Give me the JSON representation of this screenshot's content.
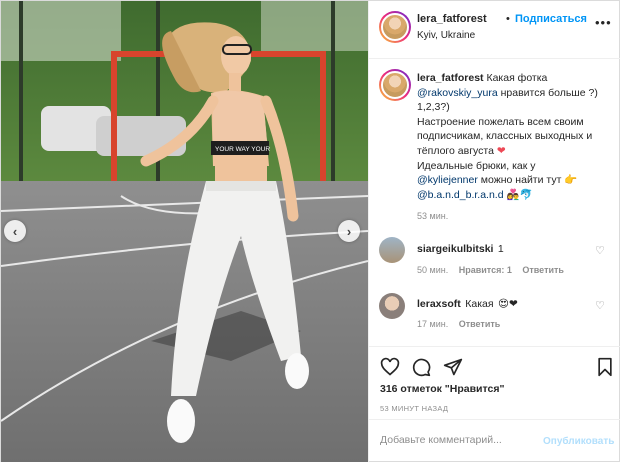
{
  "header": {
    "username": "lera_fatforest",
    "dot": "•",
    "follow_label": "Подписаться",
    "location": "Kyiv, Ukraine",
    "more": "•••",
    "more_icon": "more-horizontal-icon"
  },
  "caption": {
    "username": "lera_fatforest",
    "part1": "Какая фотка",
    "mention1": "@rakovskiy_yura",
    "part2": "нравится больше ?) 1,2,3?)",
    "part3": "Настроение пожелать всем своим подписчикам, классных выходных и тёплого августа",
    "heart": "❤",
    "part4": "Идеальные брюки, как у",
    "mention2": "@kyliejenner",
    "part5": "можно найти тут",
    "emoji_point": "👉",
    "mention3": "@b.a.n.d_b.r.a.n.d",
    "emoji_end": "👩‍❤️‍👨🐬",
    "time": "53 мин."
  },
  "comments": [
    {
      "username": "siargeikulbitski",
      "text": "1",
      "time": "50 мин.",
      "likes_label": "Нравится: 1",
      "reply_label": "Ответить"
    },
    {
      "username": "leraxsoft",
      "text": "Какая",
      "emoji": "😍❤",
      "time": "17 мин.",
      "reply_label": "Ответить"
    }
  ],
  "actions": {
    "like_icon": "heart-outline-icon",
    "comment_icon": "comment-bubble-icon",
    "share_icon": "paper-plane-icon",
    "save_icon": "bookmark-icon",
    "likes_text": "316 отметок \"Нравится\"",
    "posted_ago": "53 МИНУТ НАЗАД"
  },
  "comment_box": {
    "placeholder": "Добавьте комментарий...",
    "publish_label": "Опубликовать"
  },
  "carousel": {
    "prev_label": "‹",
    "next_label": "›"
  },
  "photo": {
    "top_text": "YOUR WAY YOUR"
  },
  "colors": {
    "link": "#00376b",
    "follow": "#0095f6",
    "muted": "#8e8e8e",
    "heart": "#ed4956",
    "court": "#7d7d7d",
    "goal": "#d8442d"
  }
}
